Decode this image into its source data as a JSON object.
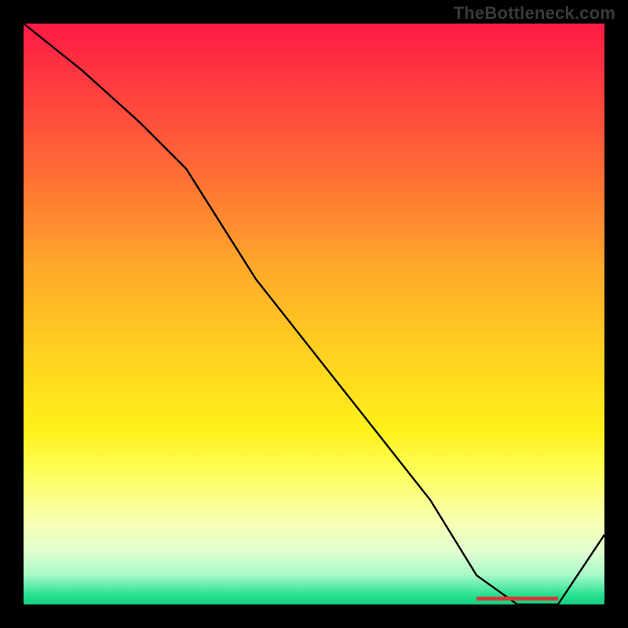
{
  "watermark": "TheBottleneck.com",
  "chart_data": {
    "type": "line",
    "title": "",
    "xlabel": "",
    "ylabel": "",
    "xlim": [
      0,
      100
    ],
    "ylim": [
      0,
      100
    ],
    "x": [
      0,
      10,
      20,
      28,
      40,
      55,
      70,
      78,
      85,
      92,
      100
    ],
    "values": [
      100,
      92,
      83,
      75,
      56,
      37,
      18,
      5,
      0,
      0,
      12
    ],
    "annotations": [
      {
        "type": "flat-segment",
        "x_start": 78,
        "x_end": 92,
        "y": 0
      }
    ]
  },
  "colors": {
    "curve": "#000000",
    "bar": "#d63a3a"
  }
}
